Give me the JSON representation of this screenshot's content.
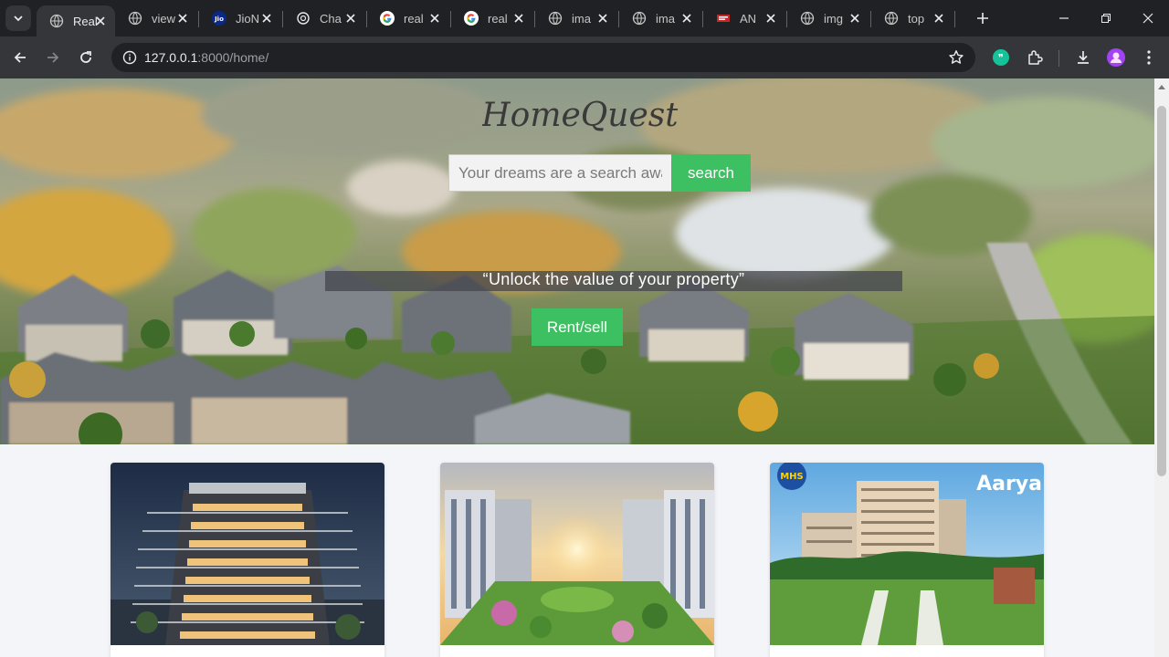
{
  "browser": {
    "tabs": [
      {
        "title": "Real",
        "icon": "globe-icon",
        "active": true
      },
      {
        "title": "view",
        "icon": "globe-icon"
      },
      {
        "title": "JioN",
        "icon": "jio-icon"
      },
      {
        "title": "Cha",
        "icon": "chatgpt-icon"
      },
      {
        "title": "real",
        "icon": "google-icon"
      },
      {
        "title": "real",
        "icon": "google-icon"
      },
      {
        "title": "ima",
        "icon": "globe-icon"
      },
      {
        "title": "ima",
        "icon": "globe-icon"
      },
      {
        "title": "AN",
        "icon": "news-icon"
      },
      {
        "title": "img",
        "icon": "globe-icon"
      },
      {
        "title": "top",
        "icon": "globe-icon"
      }
    ],
    "url_host": "127.0.0.1",
    "url_rest": ":8000/home/"
  },
  "page": {
    "logo_text": "HomeQuest",
    "search": {
      "placeholder": "Your dreams are a search away",
      "button_label": "search"
    },
    "tagline": "“Unlock the value of your property”",
    "cta_label": "Rent/sell",
    "cards": [
      {
        "image": "luxury-tower"
      },
      {
        "image": "township-garden"
      },
      {
        "image": "apartment-field",
        "badge_left": "MHS",
        "badge_right": "Aarya"
      }
    ]
  },
  "colors": {
    "accent_green": "#3cc061",
    "chrome_dark": "#202124",
    "chrome_toolbar": "#35363a"
  }
}
